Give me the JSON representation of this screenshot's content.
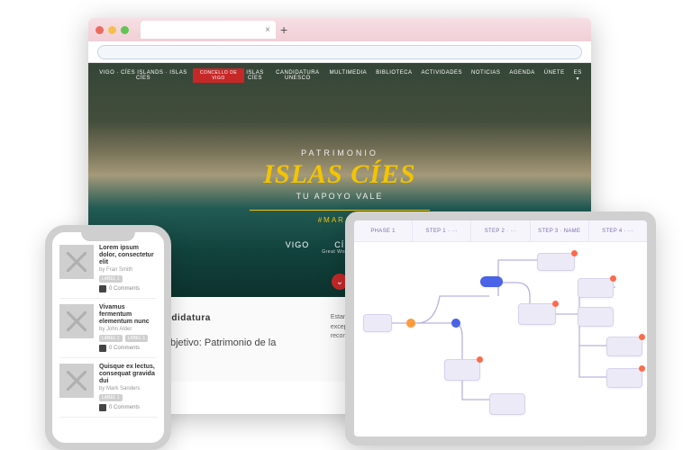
{
  "browser": {
    "tab_close": "×",
    "tab_plus": "+",
    "nav": {
      "logo_left": "VIGO · CÍES ISLANDS · ISLAS CÍES",
      "logo_right": "CONCELLO DE VIGO",
      "items": [
        "ISLAS CÍES",
        "CANDIDATURA UNESCO",
        "MULTIMEDIA",
        "BIBLIOTECA",
        "ACTIVIDADES",
        "NOTICIAS",
        "AGENDA",
        "ÚNETE",
        "ES ▾"
      ]
    },
    "hero": {
      "pre": "PATRIMONIO",
      "title": "ISLAS CÍES",
      "sub": "TU APOYO VALE",
      "hash": "#MARAVI",
      "logo1": "VIGO",
      "logo2": "CÍES ISLA",
      "logo2_sub": "Great World Heritage · Obxec",
      "scroll_icon": "⌄"
    },
    "below": {
      "heading": "Nuestra Candidatura",
      "left": "Islas Cíes, Objetivo: Patrimonio de la Humanidad.",
      "right": "Estamos convencidos de que las Islas Cíes constituyen un bien de valor universal excepcional, natural tal, que las hace merecedoras, sin lugar a dudas, de este reconocimiento internacional."
    }
  },
  "phone": {
    "items": [
      {
        "title": "Lorem ipsum dolor, consectetur elit",
        "by": "by Fran Smith",
        "labels": [
          "LABEL 1"
        ],
        "comments": "0 Comments"
      },
      {
        "title": "Vivamus fermentum elementum nunc",
        "by": "by John Alder",
        "labels": [
          "LABEL 1",
          "LABEL 1"
        ],
        "comments": "0 Comments"
      },
      {
        "title": "Quisque ex lectus, consequat gravida dui",
        "by": "by Mark Sanders",
        "labels": [
          "LABEL 1"
        ],
        "comments": "0 Comments"
      }
    ]
  },
  "tablet": {
    "steps": [
      "PHASE 1",
      "STEP 1 · ···",
      "STEP 2 · ···",
      "STEP 3 · NAME",
      "STEP 4 · ···"
    ]
  }
}
